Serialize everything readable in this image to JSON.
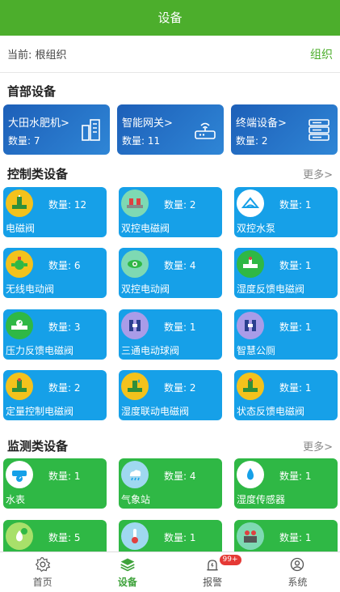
{
  "header": {
    "title": "设备"
  },
  "current": {
    "path": "当前: 根组织",
    "org_button": "组织"
  },
  "head_section": {
    "title": "首部设备",
    "cards": [
      {
        "name": "大田水肥机>",
        "count": "数量: 7",
        "icon": "building-icon"
      },
      {
        "name": "智能网关>",
        "count": "数量: 11",
        "icon": "router-icon"
      },
      {
        "name": "终端设备>",
        "count": "数量: 2",
        "icon": "server-icon"
      }
    ]
  },
  "control_section": {
    "title": "控制类设备",
    "more": "更多>",
    "items": [
      {
        "name": "电磁阀",
        "count": "数量: 12"
      },
      {
        "name": "双控电磁阀",
        "count": "数量: 2"
      },
      {
        "name": "双控水泵",
        "count": "数量: 1"
      },
      {
        "name": "无线电动阀",
        "count": "数量: 6"
      },
      {
        "name": "双控电动阀",
        "count": "数量: 4"
      },
      {
        "name": "湿度反馈电磁阀",
        "count": "数量: 1"
      },
      {
        "name": "压力反馈电磁阀",
        "count": "数量: 3"
      },
      {
        "name": "三通电动球阀",
        "count": "数量: 1"
      },
      {
        "name": "智慧公厕",
        "count": "数量: 1"
      },
      {
        "name": "定量控制电磁阀",
        "count": "数量: 2"
      },
      {
        "name": "湿度联动电磁阀",
        "count": "数量: 2"
      },
      {
        "name": "状态反馈电磁阀",
        "count": "数量: 1"
      }
    ]
  },
  "monitor_section": {
    "title": "监测类设备",
    "more": "更多>",
    "items": [
      {
        "name": "水表",
        "count": "数量: 1"
      },
      {
        "name": "气象站",
        "count": "数量: 4"
      },
      {
        "name": "湿度传感器",
        "count": "数量: 1"
      },
      {
        "name": "",
        "count": "数量: 5"
      },
      {
        "name": "",
        "count": "数量: 1"
      },
      {
        "name": "",
        "count": "数量: 1"
      }
    ]
  },
  "nav": {
    "items": [
      {
        "label": "首页",
        "icon": "gear-icon"
      },
      {
        "label": "设备",
        "icon": "layers-icon"
      },
      {
        "label": "报警",
        "icon": "alarm-icon",
        "badge": "99+"
      },
      {
        "label": "系统",
        "icon": "user-icon"
      }
    ]
  },
  "colors": {
    "brand": "#4cae2c",
    "control_card": "#16a0e8",
    "monitor_card": "#2fb845",
    "head_card": "#1d5fb8",
    "badge": "#e53935"
  }
}
